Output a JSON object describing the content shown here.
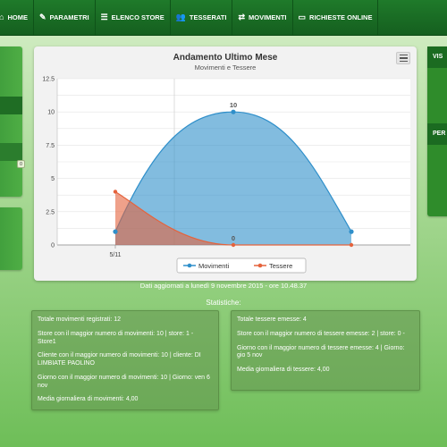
{
  "nav": {
    "items": [
      {
        "label": "HOME",
        "icon": "home-icon",
        "glyph": "⌂"
      },
      {
        "label": "PARAMETRI",
        "icon": "pencil-icon",
        "glyph": "✎"
      },
      {
        "label": "ELENCO STORE",
        "icon": "list-icon",
        "glyph": "☰"
      },
      {
        "label": "TESSERATI",
        "icon": "users-icon",
        "glyph": "👥"
      },
      {
        "label": "MOVIMENTI",
        "icon": "transfer-icon",
        "glyph": "⇄"
      },
      {
        "label": "RICHIESTE ONLINE",
        "icon": "monitor-icon",
        "glyph": "▭"
      }
    ]
  },
  "left_badge": "0",
  "right_panel": {
    "head1": "VIS",
    "head2": "PER"
  },
  "chart_data": {
    "type": "area",
    "title": "Andamento Ultimo Mese",
    "subtitle": "Movimenti e Tessere",
    "categories": [
      "5/11",
      "",
      "",
      ""
    ],
    "yticks": [
      "0",
      "2.5",
      "5",
      "7.5",
      "10",
      "12.5"
    ],
    "ylim": [
      0,
      12.5
    ],
    "series": [
      {
        "name": "Movimenti",
        "color": "#2f8fca",
        "values": [
          1,
          null,
          10,
          1
        ],
        "labels": {
          "2": "10"
        }
      },
      {
        "name": "Tessere",
        "color": "#e5633c",
        "values": [
          4,
          null,
          0,
          0
        ],
        "labels": {
          "2": "0"
        }
      }
    ],
    "legend": "bottom-center"
  },
  "updated_text": "Dati aggiornati a lunedì 9 novembre 2015 - ore 10.48.37",
  "stats_title": "Statistiche:",
  "stats_left": [
    "Totale movimenti registrati: 12",
    "Store con il maggior numero di movimenti: 10 | store: 1 - Store1",
    "Cliente con il maggior numero di movimenti: 10 | cliente: DI LIMBIATE PAOLINO",
    "Giorno con il maggior numero di movimenti: 10 | Giorno: ven 6 nov",
    "Media giornaliera di movimenti: 4,00"
  ],
  "stats_right": [
    "Totale tessere emesse: 4",
    "Store con il maggior numero di tessere emesse: 2 | store: 0 -",
    "Giorno con il maggior numero di tessere emesse: 4 | Giorno: gio 5 nov",
    "Media giornaliera di tessere: 4,00"
  ]
}
